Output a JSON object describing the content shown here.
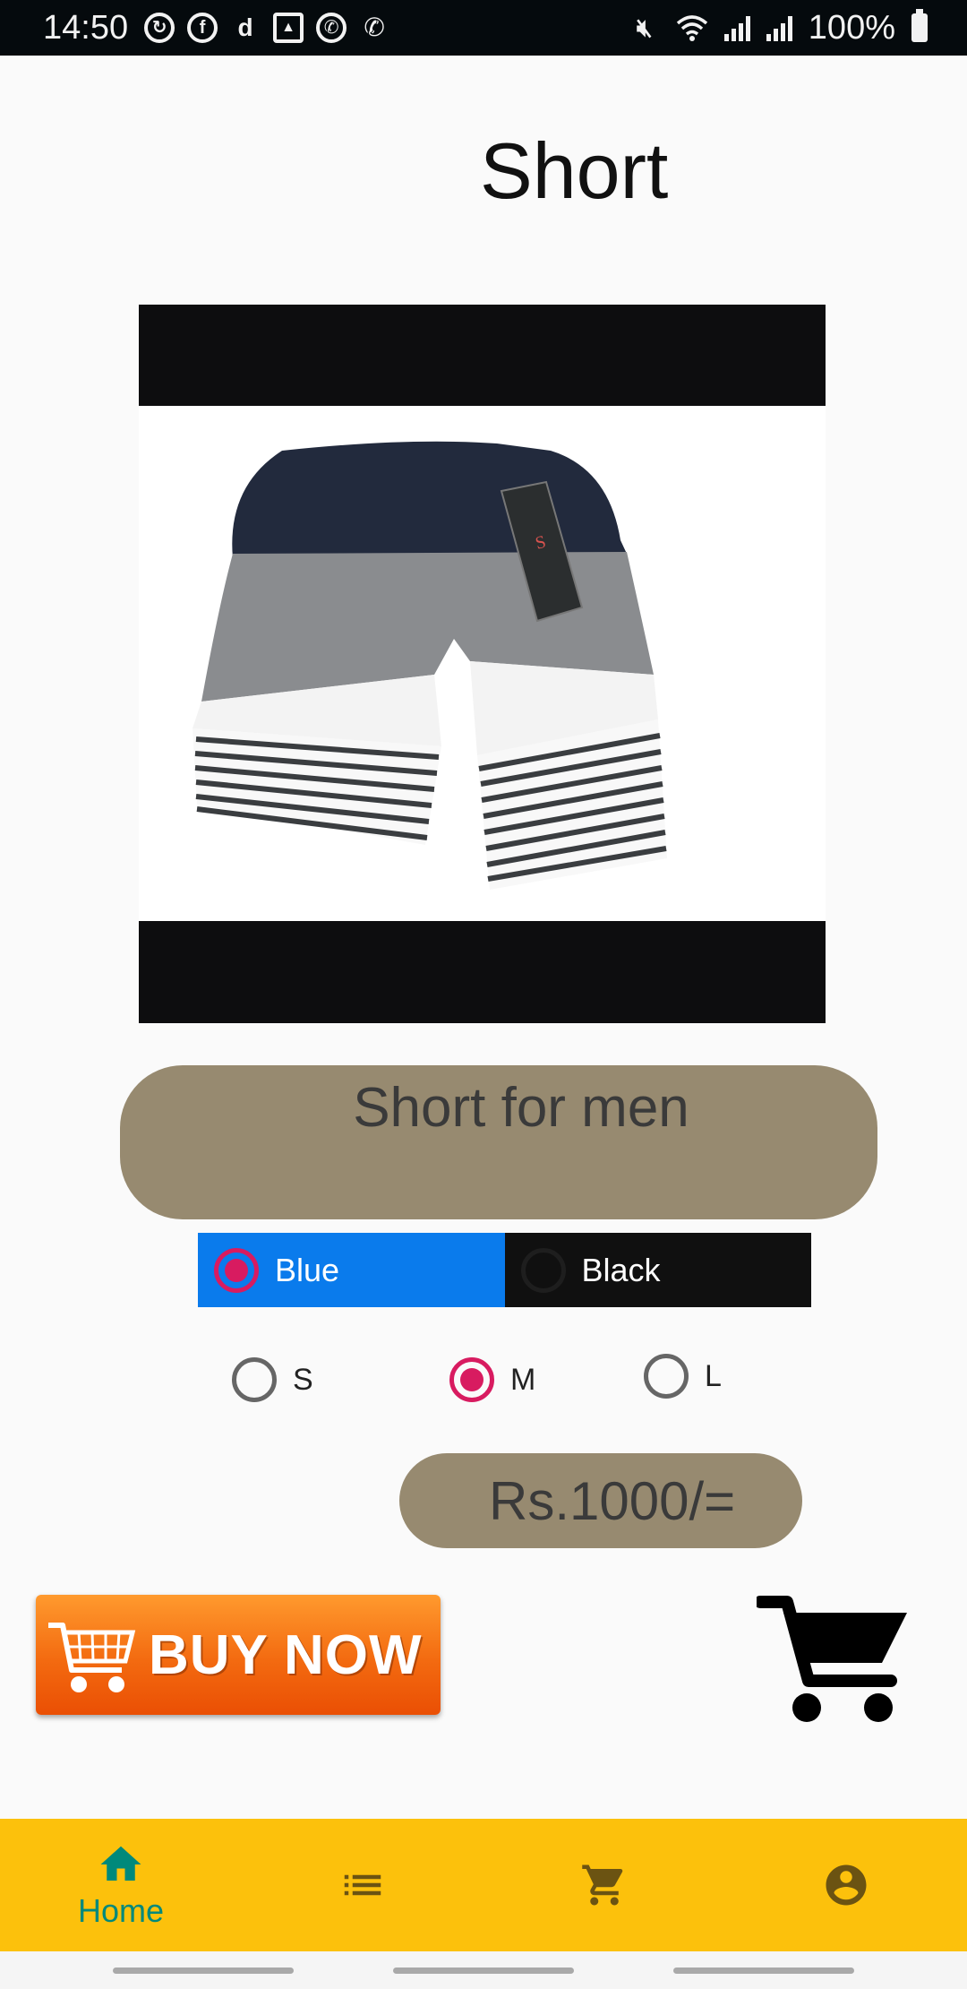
{
  "status_bar": {
    "time": "14:50",
    "battery": "100%",
    "left_icons": [
      "sync-icon",
      "facebook-icon",
      "d-icon",
      "gallery-icon",
      "whatsapp-icon",
      "wifi-call-icon"
    ],
    "right_icons": [
      "mute-icon",
      "wifi-icon",
      "signal-icon",
      "signal-icon",
      "battery-icon"
    ]
  },
  "page": {
    "title": "Short"
  },
  "product": {
    "image_icon": "shorts-image",
    "description": "Short for men",
    "price": "Rs.1000/="
  },
  "colors": {
    "options": [
      {
        "label": "Blue",
        "selected": true,
        "bg": "#0a7bec"
      },
      {
        "label": "Black",
        "selected": false,
        "bg": "#101010"
      }
    ]
  },
  "sizes": {
    "options": [
      {
        "label": "S",
        "selected": false
      },
      {
        "label": "M",
        "selected": true
      },
      {
        "label": "L",
        "selected": false
      }
    ]
  },
  "actions": {
    "buy_now_label": "BUY NOW",
    "cart_icon": "shopping-cart-icon"
  },
  "bottom_nav": {
    "items": [
      {
        "label": "Home",
        "icon": "home-icon",
        "active": true
      },
      {
        "label": "",
        "icon": "list-icon",
        "active": false
      },
      {
        "label": "",
        "icon": "cart-icon",
        "active": false
      },
      {
        "label": "",
        "icon": "account-icon",
        "active": false
      }
    ]
  },
  "theme": {
    "accent": "#00897b",
    "nav_bg": "#fcc10c",
    "pill_bg": "#978a70",
    "radio_selected": "#d81b60"
  }
}
